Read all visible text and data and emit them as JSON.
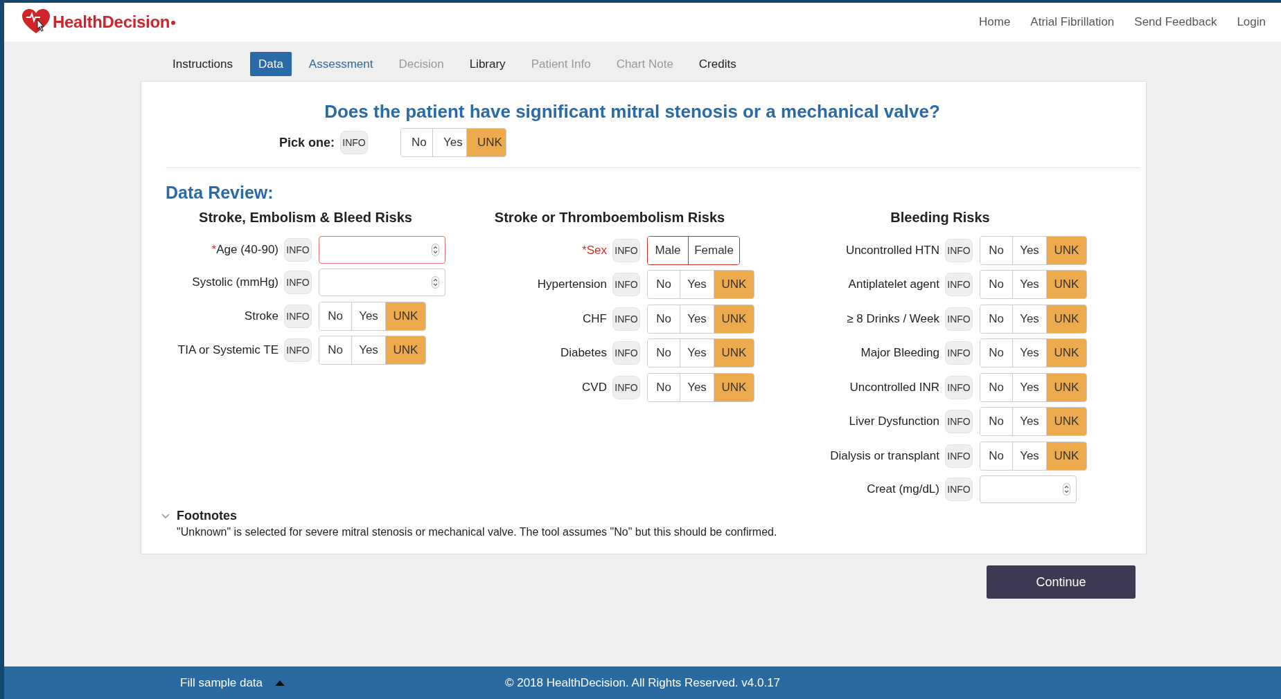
{
  "header": {
    "logo": "HealthDecision",
    "nav": [
      {
        "label": "Home"
      },
      {
        "label": "Atrial Fibrillation"
      },
      {
        "label": "Send Feedback"
      },
      {
        "label": "Login"
      }
    ]
  },
  "tabs": [
    {
      "label": "Instructions",
      "selected": false,
      "disabled": false,
      "kind": "plain"
    },
    {
      "label": "Data",
      "selected": true,
      "disabled": false,
      "kind": "plain"
    },
    {
      "label": "Assessment",
      "selected": false,
      "disabled": false,
      "kind": "link"
    },
    {
      "label": "Decision",
      "selected": false,
      "disabled": true,
      "kind": "plain"
    },
    {
      "label": "Library",
      "selected": false,
      "disabled": false,
      "kind": "plain"
    },
    {
      "label": "Patient Info",
      "selected": false,
      "disabled": true,
      "kind": "plain"
    },
    {
      "label": "Chart Note",
      "selected": false,
      "disabled": true,
      "kind": "plain"
    },
    {
      "label": "Credits",
      "selected": false,
      "disabled": false,
      "kind": "plain"
    }
  ],
  "question": {
    "title": "Does the patient have significant mitral stenosis or a mechanical valve?",
    "label": "Pick one:",
    "info": "INFO",
    "options": [
      {
        "label": "No",
        "selected": false
      },
      {
        "label": "Yes",
        "selected": false
      },
      {
        "label": "UNK",
        "selected": true
      }
    ]
  },
  "data_review": {
    "title": "Data Review:",
    "columns": [
      {
        "title": "Stroke, Embolism & Bleed Risks",
        "rows": [
          {
            "kind": "number",
            "required_mark": "*",
            "label": "Age (40-90)",
            "label_alert": false,
            "invalid": true,
            "info": "INFO"
          },
          {
            "kind": "number",
            "label": "Systolic (mmHg)",
            "label_alert": false,
            "invalid": false,
            "info": "INFO"
          },
          {
            "kind": "choice",
            "label": "Stroke",
            "label_alert": false,
            "invalid": false,
            "info": "INFO",
            "options": [
              {
                "label": "No",
                "selected": false
              },
              {
                "label": "Yes",
                "selected": false
              },
              {
                "label": "UNK",
                "selected": true
              }
            ]
          },
          {
            "kind": "choice",
            "label": "TIA or Systemic TE",
            "label_alert": false,
            "invalid": false,
            "info": "INFO",
            "options": [
              {
                "label": "No",
                "selected": false
              },
              {
                "label": "Yes",
                "selected": false
              },
              {
                "label": "UNK",
                "selected": true
              }
            ]
          }
        ]
      },
      {
        "title": "Stroke or Thromboembolism Risks",
        "rows": [
          {
            "kind": "choice",
            "required_mark": "*",
            "label": "Sex",
            "label_alert": true,
            "invalid": true,
            "info": "INFO",
            "options": [
              {
                "label": "Male",
                "selected": false
              },
              {
                "label": "Female",
                "selected": false
              }
            ]
          },
          {
            "kind": "choice",
            "label": "Hypertension",
            "label_alert": false,
            "invalid": false,
            "info": "INFO",
            "options": [
              {
                "label": "No",
                "selected": false
              },
              {
                "label": "Yes",
                "selected": false
              },
              {
                "label": "UNK",
                "selected": true
              }
            ]
          },
          {
            "kind": "choice",
            "label": "CHF",
            "label_alert": false,
            "invalid": false,
            "info": "INFO",
            "options": [
              {
                "label": "No",
                "selected": false
              },
              {
                "label": "Yes",
                "selected": false
              },
              {
                "label": "UNK",
                "selected": true
              }
            ]
          },
          {
            "kind": "choice",
            "label": "Diabetes",
            "label_alert": false,
            "invalid": false,
            "info": "INFO",
            "options": [
              {
                "label": "No",
                "selected": false
              },
              {
                "label": "Yes",
                "selected": false
              },
              {
                "label": "UNK",
                "selected": true
              }
            ]
          },
          {
            "kind": "choice",
            "label": "CVD",
            "label_alert": false,
            "invalid": false,
            "info": "INFO",
            "options": [
              {
                "label": "No",
                "selected": false
              },
              {
                "label": "Yes",
                "selected": false
              },
              {
                "label": "UNK",
                "selected": true
              }
            ]
          }
        ]
      },
      {
        "title": "Bleeding Risks",
        "rows": [
          {
            "kind": "choice",
            "label": "Uncontrolled HTN",
            "label_alert": false,
            "invalid": false,
            "info": "INFO",
            "options": [
              {
                "label": "No",
                "selected": false
              },
              {
                "label": "Yes",
                "selected": false
              },
              {
                "label": "UNK",
                "selected": true
              }
            ]
          },
          {
            "kind": "choice",
            "label": "Antiplatelet agent",
            "label_alert": false,
            "invalid": false,
            "info": "INFO",
            "options": [
              {
                "label": "No",
                "selected": false
              },
              {
                "label": "Yes",
                "selected": false
              },
              {
                "label": "UNK",
                "selected": true
              }
            ]
          },
          {
            "kind": "choice",
            "label": "≥ 8 Drinks / Week",
            "label_alert": false,
            "invalid": false,
            "info": "INFO",
            "options": [
              {
                "label": "No",
                "selected": false
              },
              {
                "label": "Yes",
                "selected": false
              },
              {
                "label": "UNK",
                "selected": true
              }
            ]
          },
          {
            "kind": "choice",
            "label": "Major Bleeding",
            "label_alert": false,
            "invalid": false,
            "info": "INFO",
            "options": [
              {
                "label": "No",
                "selected": false
              },
              {
                "label": "Yes",
                "selected": false
              },
              {
                "label": "UNK",
                "selected": true
              }
            ]
          },
          {
            "kind": "choice",
            "label": "Uncontrolled INR",
            "label_alert": false,
            "invalid": false,
            "info": "INFO",
            "options": [
              {
                "label": "No",
                "selected": false
              },
              {
                "label": "Yes",
                "selected": false
              },
              {
                "label": "UNK",
                "selected": true
              }
            ]
          },
          {
            "kind": "choice",
            "label": "Liver Dysfunction",
            "label_alert": false,
            "invalid": false,
            "info": "INFO",
            "options": [
              {
                "label": "No",
                "selected": false
              },
              {
                "label": "Yes",
                "selected": false
              },
              {
                "label": "UNK",
                "selected": true
              }
            ]
          },
          {
            "kind": "choice",
            "label": "Dialysis or transplant",
            "label_alert": false,
            "invalid": false,
            "info": "INFO",
            "options": [
              {
                "label": "No",
                "selected": false
              },
              {
                "label": "Yes",
                "selected": false
              },
              {
                "label": "UNK",
                "selected": true
              }
            ]
          },
          {
            "kind": "number",
            "label": "Creat (mg/dL)",
            "label_alert": false,
            "invalid": false,
            "info": "INFO"
          }
        ]
      }
    ]
  },
  "footnotes": {
    "title": "Footnotes",
    "expanded": true,
    "text": "\"Unknown\" is selected for severe mitral stenosis or mechanical valve. The tool assumes \"No\" but this should be confirmed."
  },
  "continue_button": "Continue",
  "footer": {
    "sample_link": "Fill sample data",
    "copyright": "© 2018 HealthDecision. All Rights Reserved. v4.0.17"
  }
}
